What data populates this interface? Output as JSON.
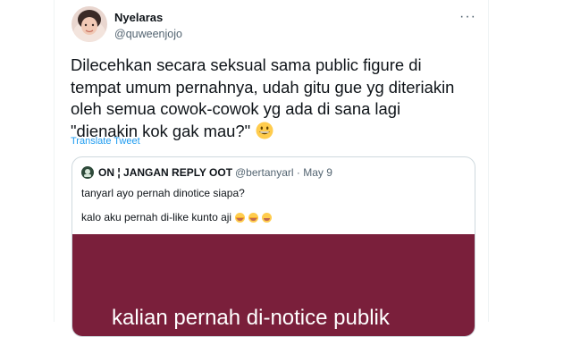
{
  "tweet": {
    "display_name": "Nyelaras",
    "handle": "@quweenjojo",
    "more_icon": "···",
    "text": "Dilecehkan secara seksual sama public figure di tempat umum pernahnya, udah gitu gue yg diteriakin oleh semua cowok-cowok yg ada di sana lagi \"dienakin kok gak mau?\"",
    "emoji": "grinning-face",
    "translate_label": "Translate Tweet"
  },
  "quote": {
    "display_name": "ON ¦ JANGAN REPLY OOT",
    "meta": "@bertanyarl · May 9",
    "line1": "tanyarl ayo pernah dinotice siapa?",
    "line2": "kalo aku pernah di-like kunto aji",
    "media_text": "kalian pernah di-notice publik",
    "media_color": "#7a1f3b"
  }
}
